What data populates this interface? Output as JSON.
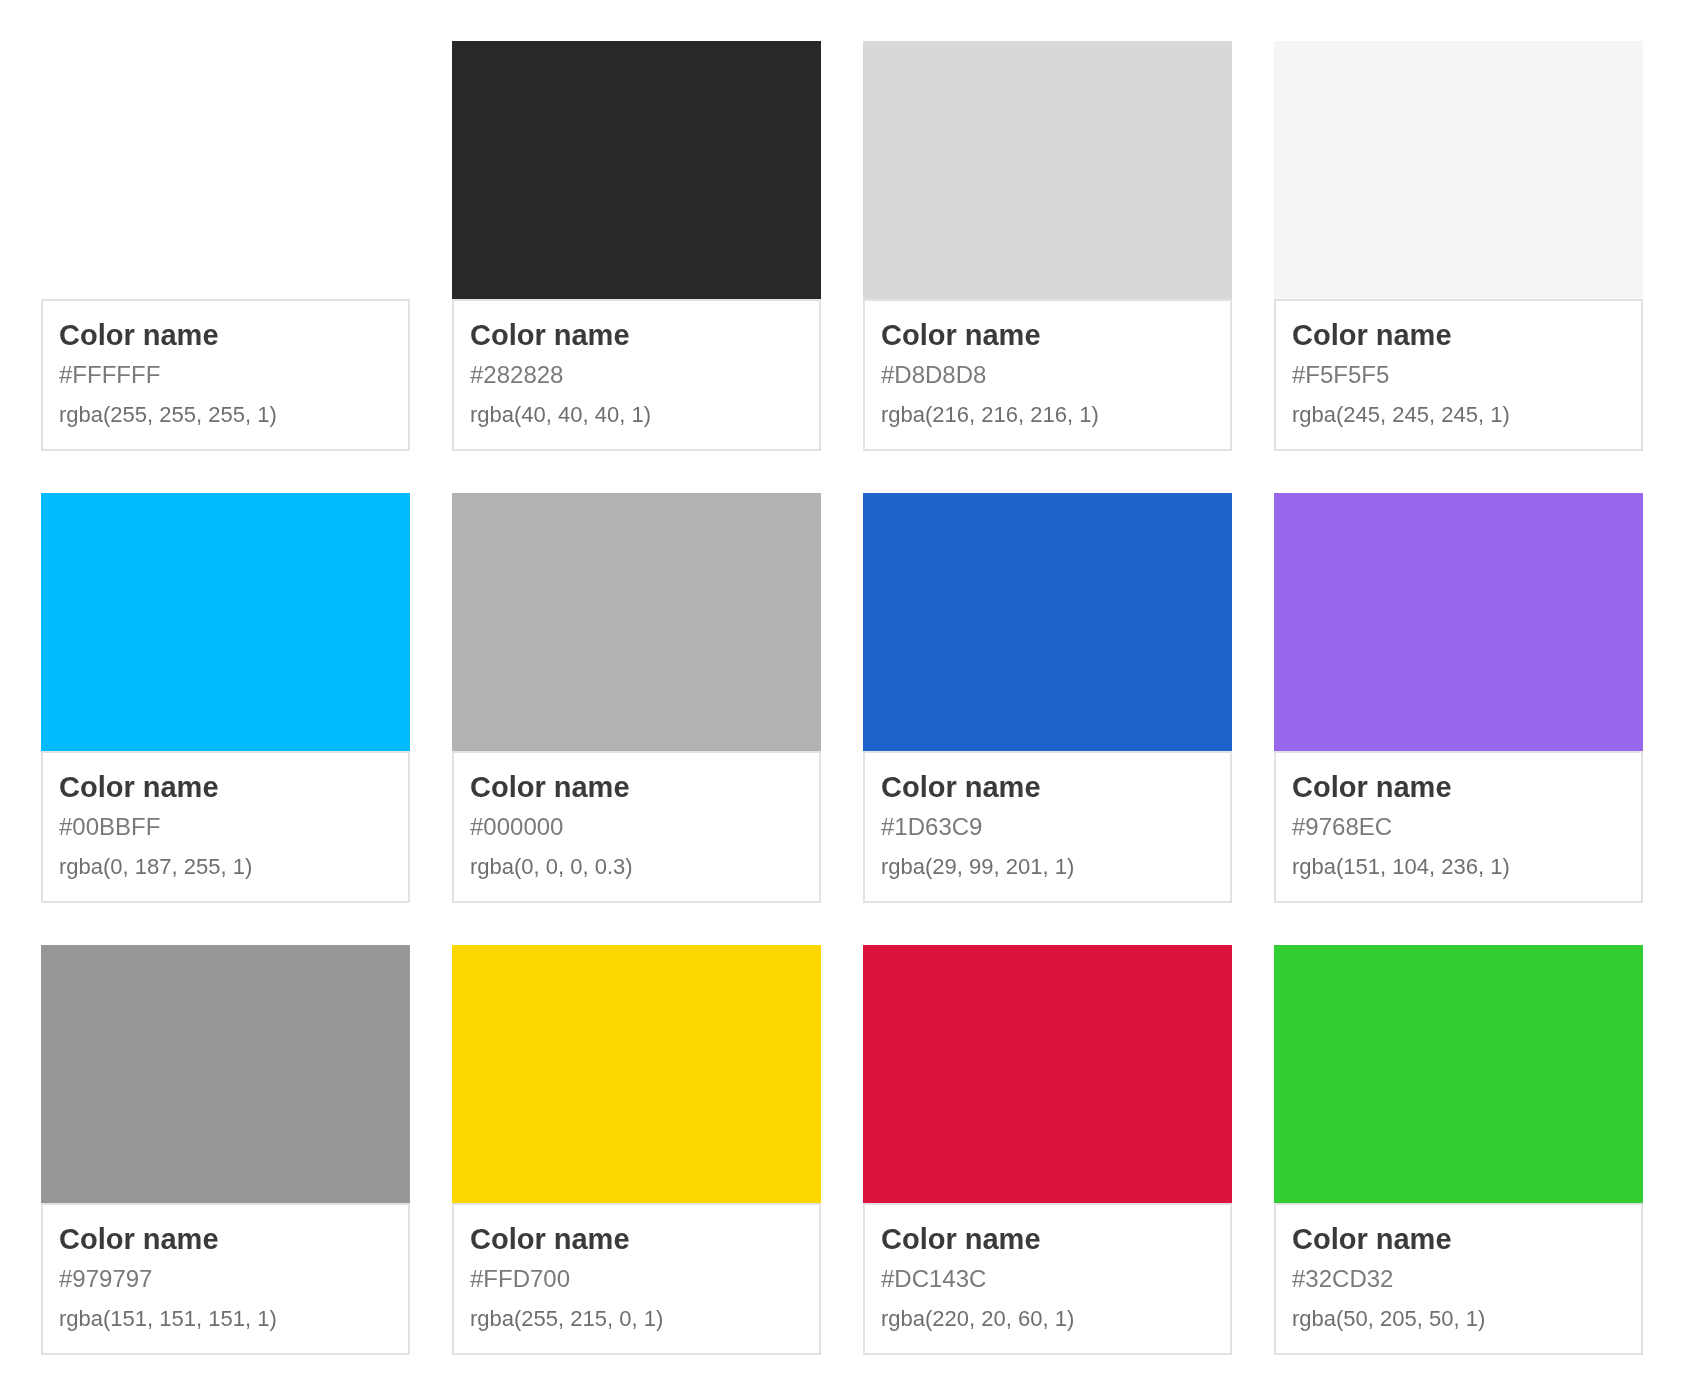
{
  "swatches": [
    {
      "name": "Color name",
      "hex": "#FFFFFF",
      "rgba": "rgba(255, 255, 255, 1)",
      "color": "#ffffff"
    },
    {
      "name": "Color name",
      "hex": "#282828",
      "rgba": "rgba(40, 40, 40, 1)",
      "color": "#282828"
    },
    {
      "name": "Color name",
      "hex": "#D8D8D8",
      "rgba": "rgba(216, 216, 216, 1)",
      "color": "#d8d8d8"
    },
    {
      "name": "Color name",
      "hex": "#F5F5F5",
      "rgba": "rgba(245, 245, 245, 1)",
      "color": "#f5f5f5"
    },
    {
      "name": "Color name",
      "hex": "#00BBFF",
      "rgba": "rgba(0, 187, 255, 1)",
      "color": "#00bbff"
    },
    {
      "name": "Color name",
      "hex": "#000000",
      "rgba": "rgba(0, 0, 0, 0.3)",
      "color": "#b2b2b2"
    },
    {
      "name": "Color name",
      "hex": "#1D63C9",
      "rgba": "rgba(29, 99, 201, 1)",
      "color": "#1d63c9"
    },
    {
      "name": "Color name",
      "hex": "#9768EC",
      "rgba": "rgba(151, 104, 236, 1)",
      "color": "#9768ec"
    },
    {
      "name": "Color name",
      "hex": "#979797",
      "rgba": "rgba(151, 151, 151, 1)",
      "color": "#979797"
    },
    {
      "name": "Color name",
      "hex": "#FFD700",
      "rgba": "rgba(255, 215, 0, 1)",
      "color": "#ffd700"
    },
    {
      "name": "Color name",
      "hex": "#DC143C",
      "rgba": "rgba(220, 20, 60, 1)",
      "color": "#dc143c"
    },
    {
      "name": "Color name",
      "hex": "#32CD32",
      "rgba": "rgba(50, 205, 50, 1)",
      "color": "#32cd32"
    }
  ]
}
